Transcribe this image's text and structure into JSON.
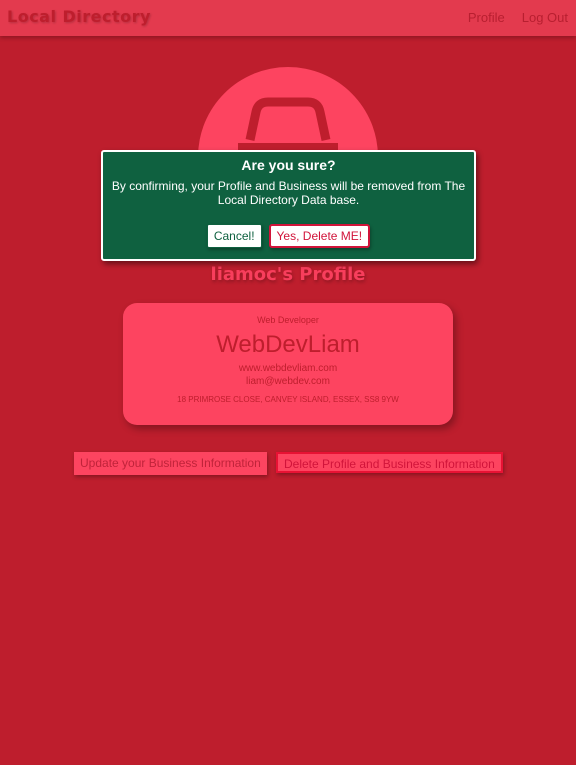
{
  "navbar": {
    "brand": "Local Directory",
    "links": [
      {
        "label": "Profile"
      },
      {
        "label": "Log Out"
      }
    ]
  },
  "avatar": {
    "icon": "user-silhouette-icon"
  },
  "modal": {
    "title": "Are you sure?",
    "message": "By confirming, your Profile and Business will be removed from The Local Directory Data base.",
    "cancel_label": "Cancel!",
    "confirm_label": "Yes, Delete ME!"
  },
  "profile": {
    "heading": "liamoc's Profile"
  },
  "card": {
    "job": "Web Developer",
    "name": "WebDevLiam",
    "url": "www.webdevliam.com",
    "email": "liam@webdev.com",
    "address": "18 PRIMROSE CLOSE, CANVEY ISLAND, ESSEX, SS8 9YW"
  },
  "actions": {
    "update_label": "Update your Business Information",
    "delete_label": "Delete Profile and Business Information"
  },
  "colors": {
    "background": "#be1e2d",
    "navbar": "#e33a4e",
    "card": "#fd4460",
    "modal": "#0f6140",
    "danger": "#d1143a"
  }
}
